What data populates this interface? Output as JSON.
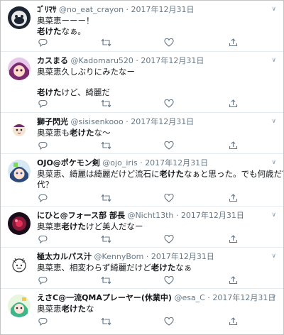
{
  "tweets": [
    {
      "name": "ｺﾞﾘﾏｻ",
      "handle": "@no_eat_crayon",
      "sep": "·",
      "date": "2017年12月31日",
      "line1_a": "奥菜恵ーーー！",
      "line2_bold": "老けた",
      "line2_b": "なぁ。"
    },
    {
      "name": "カスまる",
      "handle": "@Kadomaru520",
      "sep": "·",
      "date": "2017年12月31日",
      "line1_a": "奥菜恵久しぶりにみたなー",
      "line2_bold": "老けた",
      "line2_b": "けど、綺麗だ"
    },
    {
      "name": "獅子閃光",
      "handle": "@sisisenkooo",
      "sep": "·",
      "date": "2017年12月31日",
      "line1_a": "奥菜恵も",
      "line1_bold": "老けた",
      "line1_b": "な〜"
    },
    {
      "name": "OJO@ポケモン剣",
      "handle": "@ojo_iris",
      "sep": "·",
      "date": "2017年12月31日",
      "line1_a": "奥菜恵、綺麗は綺麗だけど流石に",
      "line1_bold": "老けた",
      "line1_b": "なぁと思った。でも何歳だ？40",
      "line2": "代？"
    },
    {
      "name": "にひと@フォース部 部長",
      "handle": "@Nicht13th",
      "sep": "·",
      "date": "2017年12月31日",
      "line1_a": "奥菜恵",
      "line1_bold": "老けた",
      "line1_b": "けど美人だなー"
    },
    {
      "name": "極太カルパス汁",
      "handle": "@KennyBom",
      "sep": "·",
      "date": "2017年12月31日",
      "line1_a": "奥菜恵、相変わらず綺麗だけど",
      "line1_bold": "老けた",
      "line1_b": "なぁ"
    },
    {
      "name": "えさC@一流QMAプレーヤー(休業中)",
      "handle": "@esa_C",
      "sep": "·",
      "date": "2017年12月31日",
      "line1_a": "奥菜恵",
      "line1_bold": "老けた",
      "line1_b": "な"
    }
  ],
  "icons": {
    "caret": "chevron-down-icon",
    "reply": "reply-icon",
    "retweet": "retweet-icon",
    "like": "heart-icon",
    "share": "share-icon"
  },
  "colors": {
    "text": "#14171a",
    "muted": "#657786",
    "divider": "#e6ecf0",
    "icon": "#657786"
  }
}
